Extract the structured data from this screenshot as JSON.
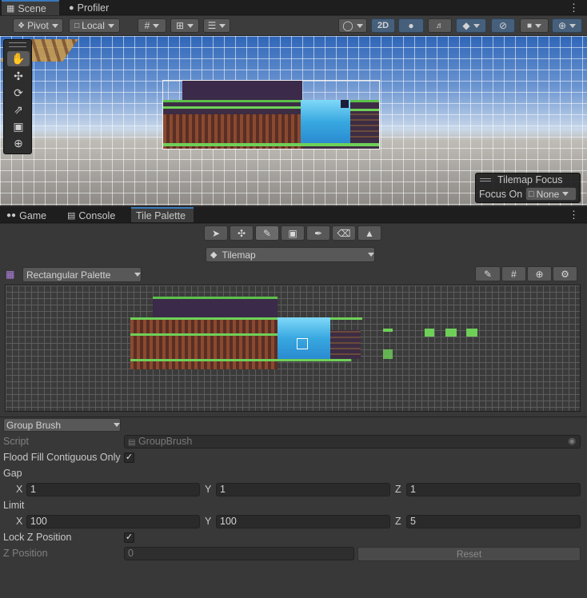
{
  "top_tabs": [
    {
      "label": "Scene",
      "icon": "grid-icon",
      "active": true
    },
    {
      "label": "Profiler",
      "icon": "profiler-icon",
      "active": false
    }
  ],
  "scene_toolbar": {
    "pivot": "Pivot",
    "local": "Local",
    "mode_2d": "2D"
  },
  "tilemap_focus": {
    "title": "Tilemap Focus",
    "focus_label": "Focus On",
    "focus_value": "None"
  },
  "bottom_tabs": [
    {
      "label": "Game",
      "icon": "gamepad-icon"
    },
    {
      "label": "Console",
      "icon": "console-icon"
    },
    {
      "label": "Tile Palette",
      "active": true
    }
  ],
  "tile_palette": {
    "active_tilemap": "Tilemap",
    "palette": "Rectangular Palette"
  },
  "brush": {
    "selected": "Group Brush",
    "script_label": "Script",
    "script_value": "GroupBrush",
    "flood_fill_label": "Flood Fill Contiguous Only",
    "flood_fill_checked": true,
    "gap_label": "Gap",
    "gap": {
      "x": "1",
      "y": "1",
      "z": "1"
    },
    "limit_label": "Limit",
    "limit": {
      "x": "100",
      "y": "100",
      "z": "5"
    },
    "lock_z_label": "Lock Z Position",
    "lock_z_checked": true,
    "z_position_label": "Z Position",
    "z_position_value": "0",
    "reset_label": "Reset",
    "axis_x": "X",
    "axis_y": "Y",
    "axis_z": "Z"
  },
  "colors": {
    "accent": "#3a79bb",
    "panel": "#282828",
    "toolbar": "#3c3c3c"
  }
}
